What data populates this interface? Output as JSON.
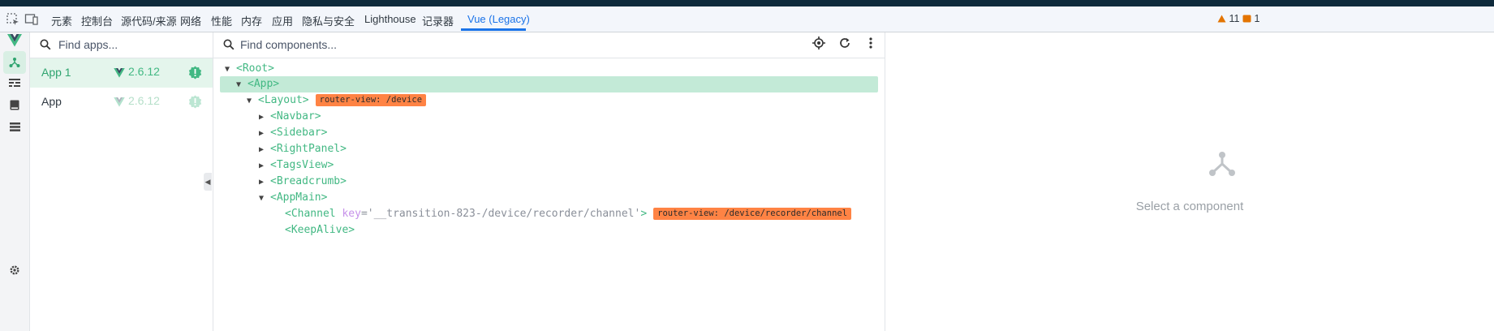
{
  "devtools": {
    "tabs": [
      {
        "label": "元素"
      },
      {
        "label": "控制台"
      },
      {
        "label": "源代码/来源"
      },
      {
        "label": "网络"
      },
      {
        "label": "性能"
      },
      {
        "label": "内存"
      },
      {
        "label": "应用"
      },
      {
        "label": "隐私与安全"
      },
      {
        "label": "Lighthouse"
      },
      {
        "label": "记录器"
      },
      {
        "label": "Vue (Legacy)"
      }
    ],
    "active_tab": "Vue (Legacy)",
    "warnings_count": "11",
    "errors_count": "1"
  },
  "apps_panel": {
    "search_placeholder": "Find apps...",
    "apps": [
      {
        "name": "App 1",
        "version": "2.6.12",
        "selected": true
      },
      {
        "name": "App",
        "version": "2.6.12",
        "selected": false
      }
    ]
  },
  "components_panel": {
    "search_placeholder": "Find components...",
    "tree": [
      {
        "label": "<Root>",
        "arrow": "▼"
      },
      {
        "label": "<App>",
        "arrow": "▼"
      },
      {
        "label": "<Layout>",
        "arrow": "▼",
        "badge": "router-view: /device"
      },
      {
        "label": "<Navbar>",
        "arrow": "▶"
      },
      {
        "label": "<Sidebar>",
        "arrow": "▶"
      },
      {
        "label": "<RightPanel>",
        "arrow": "▶"
      },
      {
        "label": "<TagsView>",
        "arrow": "▶"
      },
      {
        "label": "<Breadcrumb>",
        "arrow": "▶"
      },
      {
        "label": "<AppMain>",
        "arrow": "▼"
      },
      {
        "label": "<Channel",
        "attr_key": "key",
        "attr_val": "='__transition-823-/device/recorder/channel'",
        "close": ">",
        "badge": "router-view: /device/recorder/channel"
      },
      {
        "label": "<KeepAlive>"
      }
    ]
  },
  "inspector": {
    "empty_message": "Select a component"
  },
  "colors": {
    "vue_green": "#42b883",
    "badge_orange": "#ff8344",
    "active_tab_blue": "#1a73e8"
  }
}
